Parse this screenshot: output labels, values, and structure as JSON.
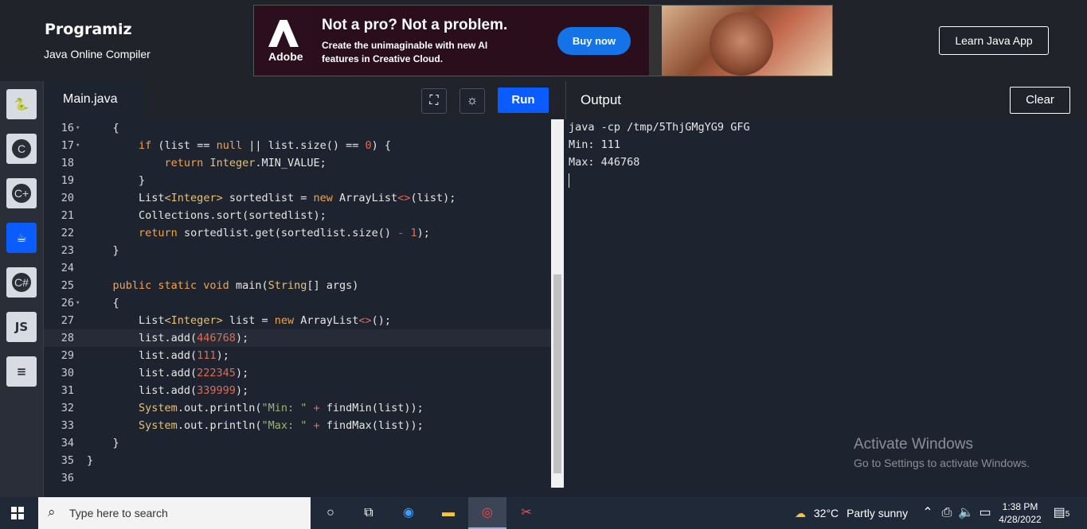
{
  "header": {
    "logo": "Programiz",
    "subtitle": "Java Online Compiler",
    "ad": {
      "brand": "Adobe",
      "title": "Not a pro? Not a problem.",
      "body": "Create the unimaginable with new AI features in Creative Cloud.",
      "button": "Buy now"
    },
    "learn_button": "Learn Java App"
  },
  "sidebar": {
    "languages": [
      {
        "name": "python",
        "label": "Py",
        "active": false
      },
      {
        "name": "c",
        "label": "C",
        "active": false
      },
      {
        "name": "cpp",
        "label": "C+",
        "active": false
      },
      {
        "name": "java",
        "label": "☕",
        "active": true
      },
      {
        "name": "csharp",
        "label": "C#",
        "active": false
      },
      {
        "name": "js",
        "label": "JS",
        "active": false
      },
      {
        "name": "sql",
        "label": "DB",
        "active": false
      }
    ]
  },
  "editor": {
    "tab": "Main.java",
    "run_label": "Run",
    "current_line": 28,
    "lines": [
      {
        "n": "16",
        "fold": true
      },
      {
        "n": "17",
        "fold": true
      },
      {
        "n": "18",
        "fold": false
      },
      {
        "n": "19",
        "fold": false
      },
      {
        "n": "20",
        "fold": false
      },
      {
        "n": "21",
        "fold": false
      },
      {
        "n": "22",
        "fold": false
      },
      {
        "n": "23",
        "fold": false
      },
      {
        "n": "24",
        "fold": false
      },
      {
        "n": "25",
        "fold": false
      },
      {
        "n": "26",
        "fold": true
      },
      {
        "n": "27",
        "fold": false
      },
      {
        "n": "28",
        "fold": false
      },
      {
        "n": "29",
        "fold": false
      },
      {
        "n": "30",
        "fold": false
      },
      {
        "n": "31",
        "fold": false
      },
      {
        "n": "32",
        "fold": false
      },
      {
        "n": "33",
        "fold": false
      },
      {
        "n": "34",
        "fold": false
      },
      {
        "n": "35",
        "fold": false
      },
      {
        "n": "36",
        "fold": false
      }
    ]
  },
  "output": {
    "title": "Output",
    "clear_label": "Clear",
    "lines": [
      "java -cp /tmp/5ThjGMgYG9 GFG",
      "Min: 111",
      "Max: 446768"
    ]
  },
  "watermark": {
    "title": "Activate Windows",
    "subtitle": "Go to Settings to activate Windows."
  },
  "taskbar": {
    "search_placeholder": "Type here to search",
    "temperature": "32°C",
    "weather": "Partly sunny",
    "time": "1:38 PM",
    "date": "4/28/2022",
    "notifications": "5"
  }
}
